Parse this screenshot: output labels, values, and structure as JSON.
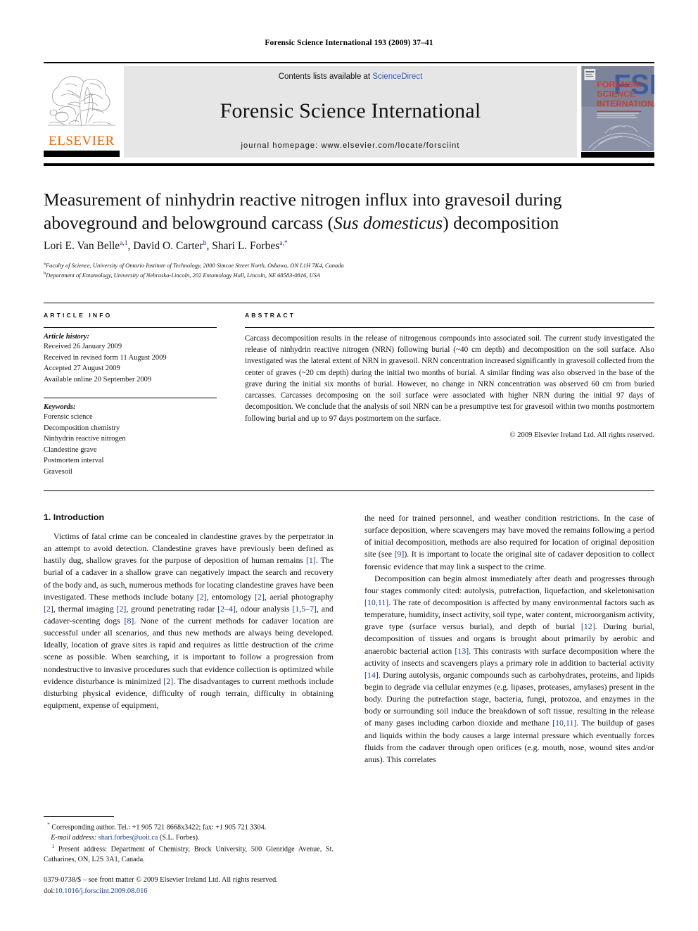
{
  "running_head": "Forensic Science International 193 (2009) 37–41",
  "masthead": {
    "contents_prefix": "Contents lists available at ",
    "sciencedirect": "ScienceDirect",
    "journal_name": "Forensic Science International",
    "homepage": "journal homepage: www.elsevier.com/locate/forsciint",
    "publisher_wordmark": "ELSEVIER",
    "cover_title_lines": [
      "FORENSIC",
      "SCIENCE",
      "INTERNATIONAL"
    ],
    "cover_logo": "FSI",
    "accent_orange": "#EC6607",
    "band_gray": "#E6E6E6",
    "link_blue": "#2A5DB0"
  },
  "article": {
    "title_line1": "Measurement of ninhydrin reactive nitrogen influx into gravesoil during",
    "title_line2_pre": "aboveground and belowground carcass (",
    "title_species": "Sus domesticus",
    "title_line2_post": ") decomposition",
    "authors": [
      {
        "name": "Lori E. Van Belle",
        "marks": "a,1",
        "sep": ", "
      },
      {
        "name": "David O. Carter",
        "marks": "b",
        "sep": ", "
      },
      {
        "name": "Shari L. Forbes",
        "marks": "a,*",
        "sep": ""
      }
    ],
    "affiliations": [
      {
        "mark": "a",
        "text": "Faculty of Science, University of Ontario Institute of Technology, 2000 Simcoe Street North, Oshawa, ON L1H 7K4, Canada"
      },
      {
        "mark": "b",
        "text": "Department of Entomology, University of Nebraska-Lincoln, 202 Entomology Hall, Lincoln, NE 68583-0816, USA"
      }
    ]
  },
  "article_info": {
    "heading": "ARTICLE INFO",
    "history_label": "Article history:",
    "history": [
      "Received 26 January 2009",
      "Received in revised form 11 August 2009",
      "Accepted 27 August 2009",
      "Available online 20 September 2009"
    ],
    "keywords_label": "Keywords:",
    "keywords": [
      "Forensic science",
      "Decomposition chemistry",
      "Ninhydrin reactive nitrogen",
      "Clandestine grave",
      "Postmortem interval",
      "Gravesoil"
    ]
  },
  "abstract": {
    "heading": "ABSTRACT",
    "text": "Carcass decomposition results in the release of nitrogenous compounds into associated soil. The current study investigated the release of ninhydrin reactive nitrogen (NRN) following burial (~40 cm depth) and decomposition on the soil surface. Also investigated was the lateral extent of NRN in gravesoil. NRN concentration increased significantly in gravesoil collected from the center of graves (~20 cm depth) during the initial two months of burial. A similar finding was also observed in the base of the grave during the initial six months of burial. However, no change in NRN concentration was observed 60 cm from buried carcasses. Carcasses decomposing on the soil surface were associated with higher NRN during the initial 97 days of decomposition. We conclude that the analysis of soil NRN can be a presumptive test for gravesoil within two months postmortem following burial and up to 97 days postmortem on the surface.",
    "copyright": "© 2009 Elsevier Ireland Ltd. All rights reserved."
  },
  "sections": {
    "intro_heading": "1. Introduction"
  },
  "body": {
    "left_p1": "Victims of fatal crime can be concealed in clandestine graves by the perpetrator in an attempt to avoid detection. Clandestine graves have previously been defined as hastily dug, shallow graves for the purpose of deposition of human remains [1]. The burial of a cadaver in a shallow grave can negatively impact the search and recovery of the body and, as such, numerous methods for locating clandestine graves have been investigated. These methods include botany [2], entomology [2], aerial photography [2], thermal imaging [2], ground penetrating radar [2–4], odour analysis [1,5–7], and cadaver-scenting dogs [8]. None of the current methods for cadaver location are successful under all scenarios, and thus new methods are always being developed. Ideally, location of grave sites is rapid and requires as little destruction of the crime scene as possible. When searching, it is important to follow a progression from nondestructive to invasive procedures such that evidence collection is optimized while evidence disturbance is minimized [2]. The disadvantages to current methods include disturbing physical evidence, difficulty of rough terrain, difficulty in obtaining equipment, expense of equipment,",
    "right_p1_cont": "the need for trained personnel, and weather condition restrictions. In the case of surface deposition, where scavengers may have moved the remains following a period of initial decomposition, methods are also required for location of original deposition site (see [9]). It is important to locate the original site of cadaver deposition to collect forensic evidence that may link a suspect to the crime.",
    "right_p2": "Decomposition can begin almost immediately after death and progresses through four stages commonly cited: autolysis, putrefaction, liquefaction, and skeletonisation [10,11]. The rate of decomposition is affected by many environmental factors such as temperature, humidity, insect activity, soil type, water content, microorganism activity, grave type (surface versus burial), and depth of burial [12]. During burial, decomposition of tissues and organs is brought about primarily by aerobic and anaerobic bacterial action [13]. This contrasts with surface decomposition where the activity of insects and scavengers plays a primary role in addition to bacterial activity [14]. During autolysis, organic compounds such as carbohydrates, proteins, and lipids begin to degrade via cellular enzymes (e.g. lipases, proteases, amylases) present in the body. During the putrefaction stage, bacteria, fungi, protozoa, and enzymes in the body or surrounding soil induce the breakdown of soft tissue, resulting in the release of many gases including carbon dioxide and methane [10,11]. The buildup of gases and liquids within the body causes a large internal pressure which eventually forces fluids from the cadaver through open orifices (e.g. mouth, nose, wound sites and/or anus). This correlates"
  },
  "footnotes": {
    "corresponding_mark": "*",
    "corresponding": "Corresponding author. Tel.: +1 905 721 8668x3422; fax: +1 905 721 3304.",
    "email_label": "E-mail address:",
    "email": "shari.forbes@uoit.ca",
    "email_owner": "(S.L. Forbes).",
    "present_mark": "1",
    "present_address": "Present address: Department of Chemistry, Brock University, 500 Glenridge Avenue, St. Catharines, ON, L2S 3A1, Canada."
  },
  "imprint": {
    "line1": "0379-0738/$ – see front matter © 2009 Elsevier Ireland Ltd. All rights reserved.",
    "doi_label": "doi:",
    "doi": "10.1016/j.forsciint.2009.08.016"
  }
}
